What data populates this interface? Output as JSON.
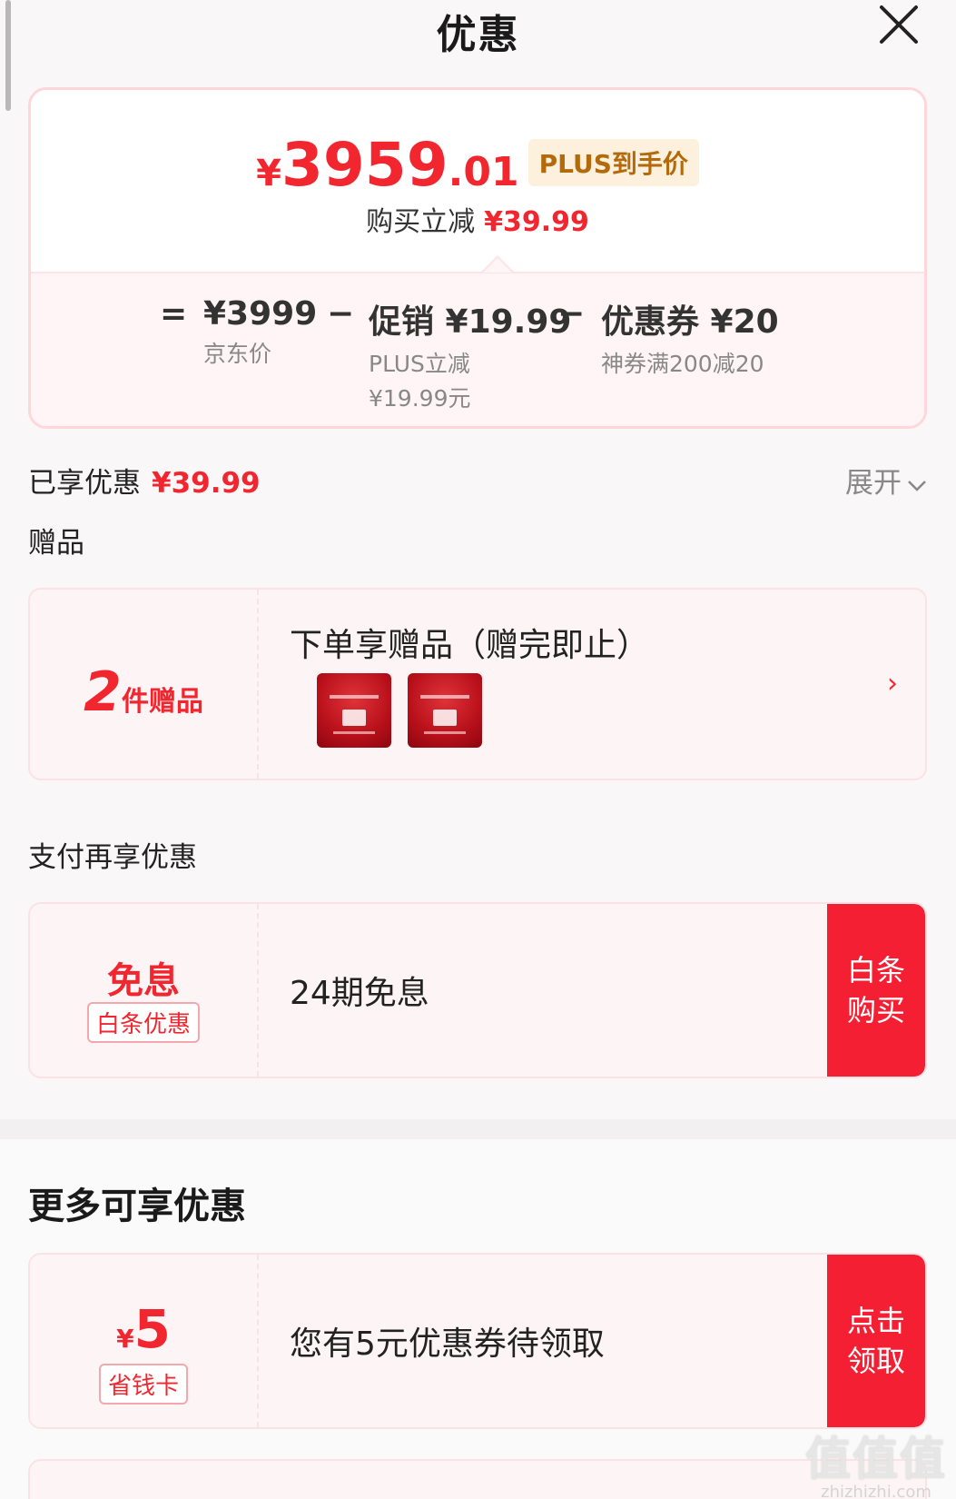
{
  "header": {
    "title": "优惠",
    "close_icon": "close-icon"
  },
  "summary": {
    "currency": "¥",
    "price_int": "3959",
    "price_dec": ".01",
    "badge": "PLUS到手价",
    "sub_label": "购买立减",
    "sub_value": "¥39.99",
    "formula": {
      "eq": "=",
      "minus": "−",
      "jd_price": {
        "value": "¥3999",
        "label": "京东价"
      },
      "promo": {
        "value": "促销 ¥19.99",
        "label": "PLUS立减",
        "label2": "¥19.99元"
      },
      "coupon": {
        "value": "优惠券 ¥20",
        "label": "神券满200减20"
      }
    }
  },
  "enjoyed": {
    "label": "已享优惠",
    "value": "¥39.99",
    "expand": "展开"
  },
  "gifts": {
    "section": "赠品",
    "count": "2",
    "count_unit": "件赠品",
    "title": "下单享赠品（赠完即止）",
    "thumbs": [
      "gift-thumb-1",
      "gift-thumb-2"
    ],
    "arrow": "›"
  },
  "pay": {
    "section": "支付再享优惠",
    "main": "免息",
    "tag": "白条优惠",
    "text": "24期免息",
    "cta": "白条购买"
  },
  "more": {
    "section": "更多可享优惠",
    "currency": "¥",
    "amount": "5",
    "tag": "省钱卡",
    "text": "您有5元优惠券待领取",
    "cta": "点击领取"
  },
  "watermark": {
    "big": "值值值",
    "small": "zhizhizhi.com"
  },
  "colors": {
    "accent": "#f1262f",
    "cta": "#f41f33",
    "badge_bg": "#fdf0dc",
    "badge_text": "#b36a0c"
  }
}
